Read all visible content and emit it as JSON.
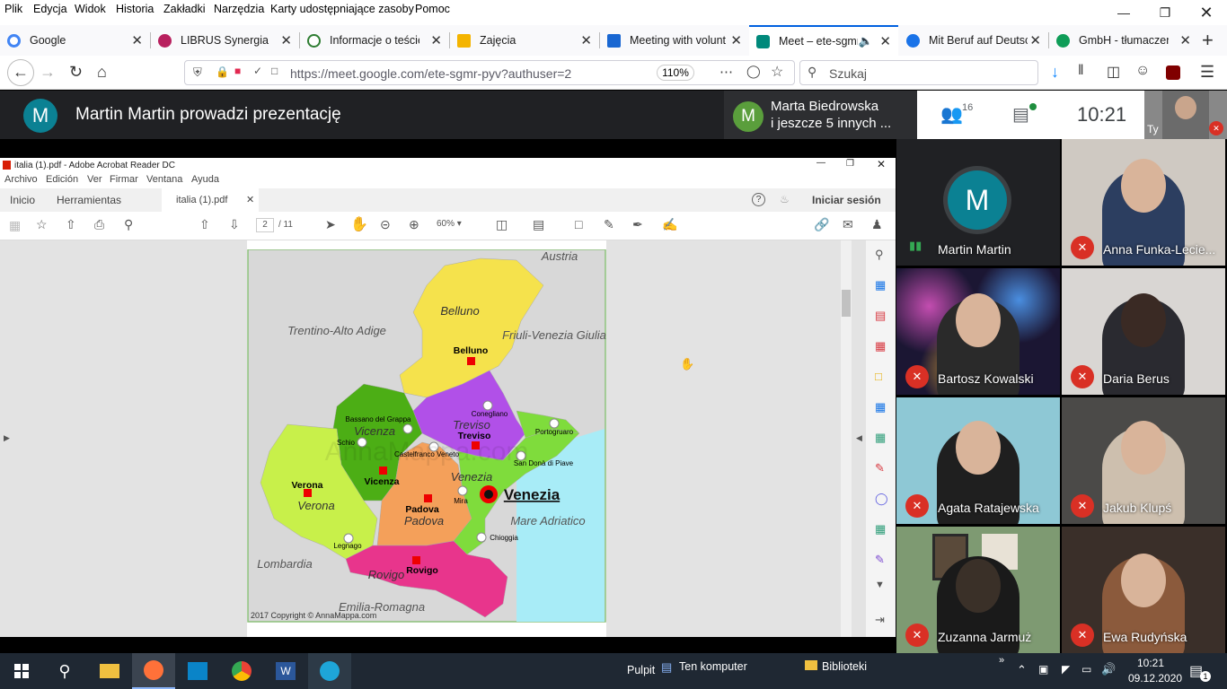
{
  "menubar": [
    "Plik",
    "Edycja",
    "Widok",
    "Historia",
    "Zakładki",
    "Narzędzia",
    "Karty udostępniające zasoby",
    "Pomoc"
  ],
  "tabs": [
    {
      "label": "Google",
      "color": "#4285f4"
    },
    {
      "label": "LIBRUS Synergia",
      "color": "#b8205e"
    },
    {
      "label": "Informacje o teście",
      "color": "#2e7d32"
    },
    {
      "label": "Zajęcia",
      "color": "#f4b400"
    },
    {
      "label": "Meeting with volunt",
      "color": "#1967d2"
    },
    {
      "label": "Meet – ete-sgmr",
      "color": "#00897b"
    },
    {
      "label": "Mit Beruf auf Deutsc",
      "color": "#1a73e8"
    },
    {
      "label": "GmbH - tłumaczeni",
      "color": "#0f9d58"
    }
  ],
  "nav": {
    "url": "https://meet.google.com/ete-sgmr-pyv?authuser=2",
    "url_host": "meet.google.com",
    "zoom": "110%",
    "search_placeholder": "Szukaj"
  },
  "meet": {
    "presenter_initial": "M",
    "presenter_title": "Martin Martin prowadzi prezentację",
    "others_initial": "M",
    "others_line1": "Marta Biedrowska",
    "others_line2": "i jeszcze 5 innych ...",
    "participants_count": "16",
    "time": "10:21",
    "self_label": "Ty"
  },
  "acrobat": {
    "window_title": "italia (1).pdf - Adobe Acrobat Reader DC",
    "menu": [
      "Archivo",
      "Edición",
      "Ver",
      "Firmar",
      "Ventana",
      "Ayuda"
    ],
    "tabs": [
      "Inicio",
      "Herramientas",
      "italia (1).pdf"
    ],
    "signin": "Iniciar sesión",
    "page_current": "2",
    "page_total": "/ 11",
    "zoom": "60%"
  },
  "map": {
    "regions": [
      "Belluno",
      "Treviso",
      "Vicenza",
      "Verona",
      "Padova",
      "Rovigo",
      "Venezia"
    ],
    "neighbors": [
      "Austria",
      "Trentino-Alto Adige",
      "Friuli-Venezia Giulia",
      "Lombardia",
      "Emilia-Romagna",
      "Mare Adriatico"
    ],
    "capitals": [
      "Belluno",
      "Treviso",
      "Vicenza",
      "Verona",
      "Padova",
      "Rovigo",
      "Venezia"
    ],
    "towns": [
      "Bassano del Grappa",
      "Schio",
      "Conegliano",
      "Castelfranco Veneto",
      "Portogruaro",
      "San Donà di Piave",
      "Mira",
      "Chioggia",
      "Legnago"
    ],
    "watermark": "AnnaMappa.com",
    "copyright": "2017 Copyright © AnnaMappa.com",
    "colors": {
      "belluno": "#f5e24c",
      "treviso": "#b150e8",
      "vicenza": "#4cae15",
      "verona": "#c8f04a",
      "padova": "#f4a05a",
      "rovigo": "#e8358c",
      "venezia": "#7fdc3c",
      "sea": "#a8ecf7",
      "land": "#d8d8d8"
    }
  },
  "participants": [
    {
      "name": "Martin Martin",
      "initial": "M",
      "muted": false,
      "bg": "#202124"
    },
    {
      "name": "Anna Funka-Lecie...",
      "muted": true,
      "bg": "#cfc9c2",
      "shirt": "#2c3e60"
    },
    {
      "name": "Bartosz Kowalski",
      "muted": true,
      "bg": "#1b1633",
      "shirt": "#2a2a2a"
    },
    {
      "name": "Daria Berus",
      "muted": true,
      "bg": "#d9d6d3",
      "shirt": "#2a2a30"
    },
    {
      "name": "Agata Ratajewska",
      "muted": true,
      "bg": "#8ec8d5",
      "shirt": "#1f1f1f"
    },
    {
      "name": "Jakub Klupś",
      "muted": true,
      "bg": "#4b4a48",
      "shirt": "#cdbfae"
    },
    {
      "name": "Zuzanna Jarmuż",
      "muted": true,
      "bg": "#7e9a72",
      "shirt": "#1a1a1a"
    },
    {
      "name": "Ewa Rudyńska",
      "muted": true,
      "bg": "#3a2f29",
      "shirt": "#8b5a3c"
    }
  ],
  "taskbar": {
    "desktop": "Pulpit",
    "computer": "Ten komputer",
    "libraries": "Biblioteki",
    "time": "10:21",
    "date": "09.12.2020",
    "notif": "1"
  }
}
